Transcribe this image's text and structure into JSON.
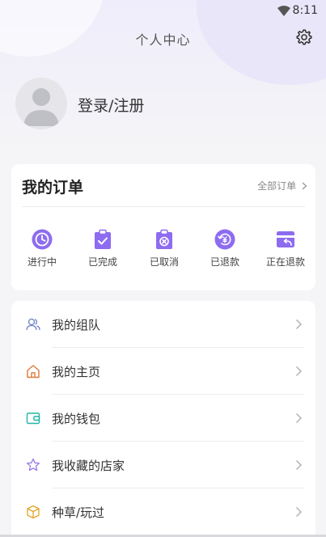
{
  "status_bar": {
    "time": "8:11"
  },
  "header": {
    "title": "个人中心"
  },
  "profile": {
    "login_label": "登录/注册"
  },
  "orders": {
    "title": "我的订单",
    "all_label": "全部订单",
    "items": [
      {
        "label": "进行中",
        "icon": "clock-icon"
      },
      {
        "label": "已完成",
        "icon": "clipboard-check-icon"
      },
      {
        "label": "已取消",
        "icon": "clipboard-x-icon"
      },
      {
        "label": "已退款",
        "icon": "refund-icon"
      },
      {
        "label": "正在退款",
        "icon": "card-return-icon"
      }
    ]
  },
  "menu": {
    "items": [
      {
        "label": "我的组队",
        "icon": "team-icon"
      },
      {
        "label": "我的主页",
        "icon": "home-icon"
      },
      {
        "label": "我的钱包",
        "icon": "wallet-icon"
      },
      {
        "label": "我收藏的店家",
        "icon": "star-icon"
      },
      {
        "label": "种草/玩过",
        "icon": "box-icon"
      }
    ]
  },
  "colors": {
    "accent": "#8d6cf0",
    "team": "#6b82c8",
    "home": "#e07a3b",
    "wallet": "#21b6a8",
    "star": "#9a7be8",
    "box": "#e3a524"
  }
}
